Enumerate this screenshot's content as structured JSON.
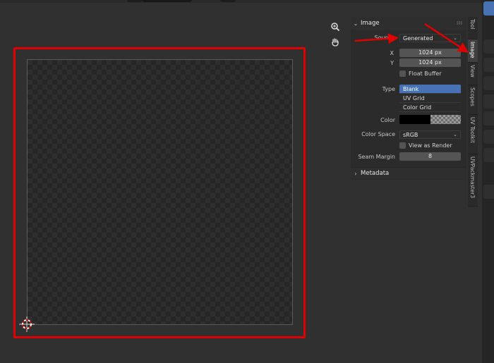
{
  "image_panel": {
    "title": "Image",
    "source_label": "Source",
    "source_value": "Generated",
    "x_label": "X",
    "x_value": "1024 px",
    "y_label": "Y",
    "y_value": "1024 px",
    "float_buffer_label": "Float Buffer",
    "float_buffer_checked": false,
    "type_label": "Type",
    "type_options": [
      "Blank",
      "UV Grid",
      "Color Grid"
    ],
    "type_selected": "Blank",
    "color_label": "Color",
    "color_value": "#000000",
    "color_space_label": "Color Space",
    "color_space_value": "sRGB",
    "view_as_render_label": "View as Render",
    "view_as_render_checked": false,
    "seam_margin_label": "Seam Margin",
    "seam_margin_value": "8"
  },
  "metadata_panel": {
    "title": "Metadata"
  },
  "sidebar_tabs": [
    "Tool",
    "Image",
    "View",
    "Scopes",
    "UV Toolkit",
    "UVPackmaster3"
  ],
  "active_tab": "Image",
  "nav_icons": [
    "zoom-icon",
    "hand-pan-icon"
  ],
  "annotation_color": "#e00000",
  "selection_color": "#4772b3"
}
